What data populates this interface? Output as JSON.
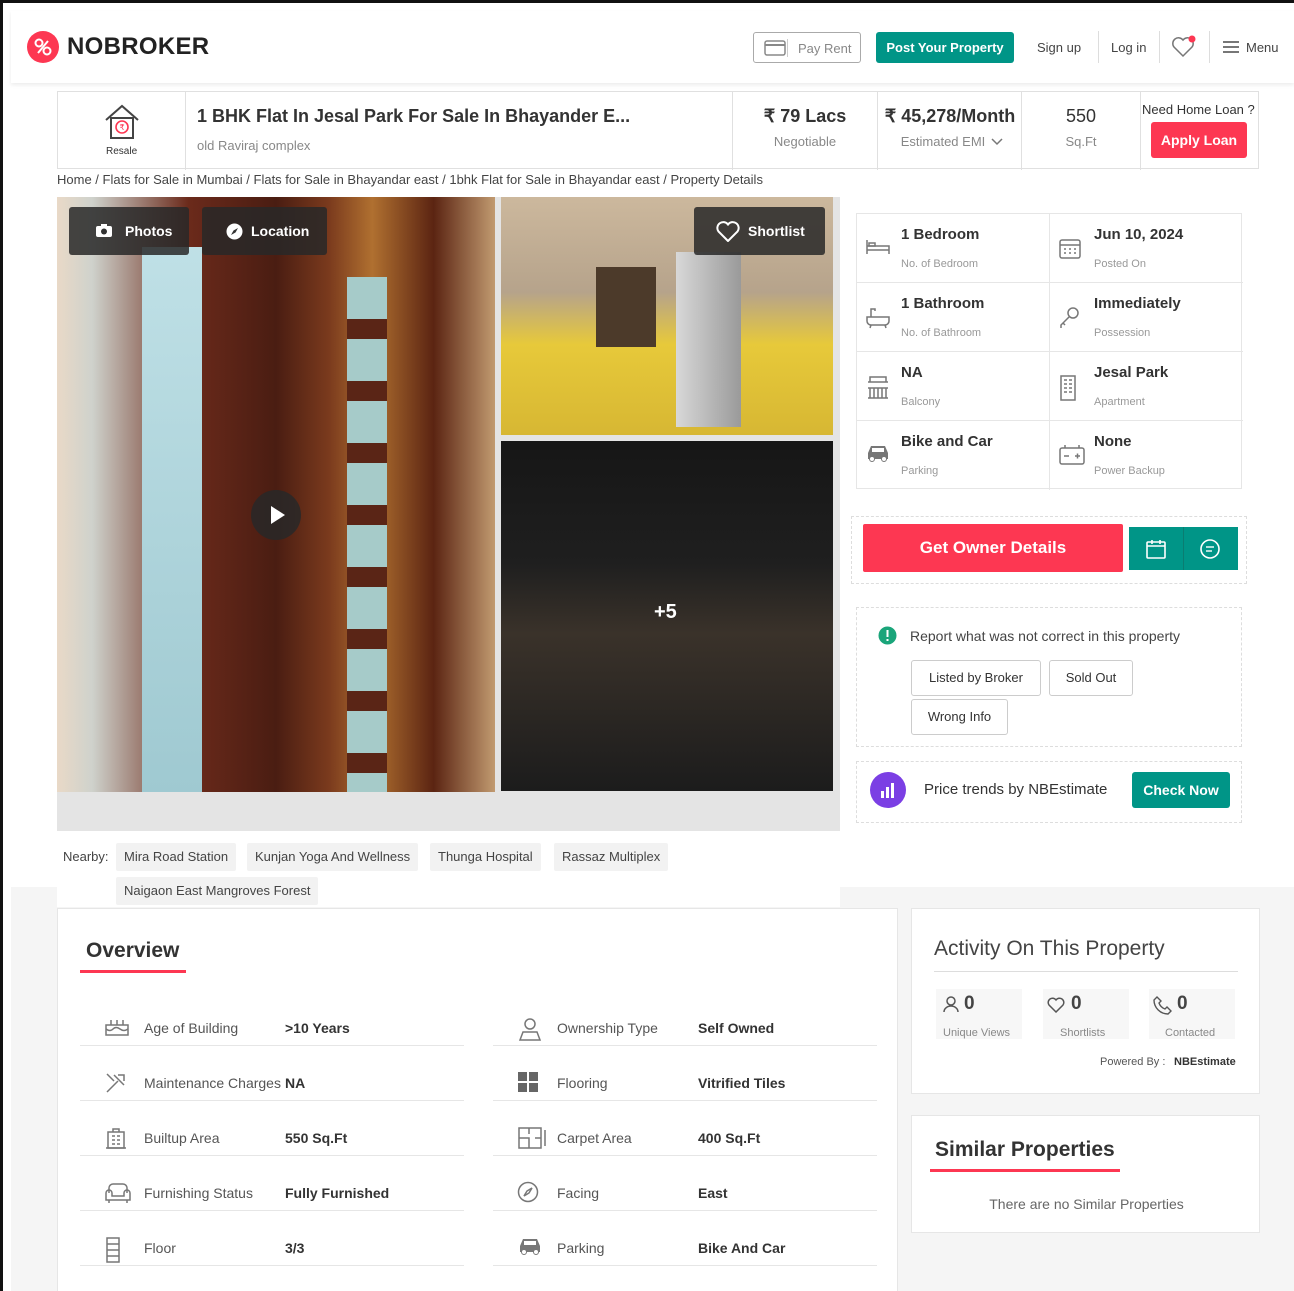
{
  "header": {
    "logo_text": "NOBROKER",
    "pay_rent": "Pay Rent",
    "post_property": "Post Your Property",
    "sign_up": "Sign up",
    "log_in": "Log in",
    "menu": "Menu",
    "brand_color": "#fd3752",
    "accent_color": "#009587"
  },
  "summary": {
    "badge": "Resale",
    "title": "1 BHK Flat In Jesal Park For Sale In Bhayander E...",
    "subtitle": "old Raviraj complex",
    "price": "₹ 79 Lacs",
    "price_note": "Negotiable",
    "emi": "₹ 45,278/Month",
    "emi_note": "Estimated EMI",
    "area": "550",
    "area_unit": "Sq.Ft",
    "loan_prompt": "Need Home Loan ?",
    "apply_loan": "Apply Loan"
  },
  "breadcrumb": "Home / Flats for Sale in Mumbai / Flats for Sale in Bhayandar east / 1bhk Flat for Sale in Bhayandar east / Property Details",
  "gallery": {
    "photos": "Photos",
    "location": "Location",
    "shortlist": "Shortlist",
    "more_count": "+5"
  },
  "details": [
    {
      "value": "1 Bedroom",
      "label": "No. of Bedroom",
      "icon": "bed-icon"
    },
    {
      "value": "Jun 10, 2024",
      "label": "Posted On",
      "icon": "calendar-icon"
    },
    {
      "value": "1 Bathroom",
      "label": "No. of Bathroom",
      "icon": "bathtub-icon"
    },
    {
      "value": "Immediately",
      "label": "Possession",
      "icon": "key-icon"
    },
    {
      "value": "NA",
      "label": "Balcony",
      "icon": "balcony-icon"
    },
    {
      "value": "Jesal Park",
      "label": "Apartment",
      "icon": "building-icon"
    },
    {
      "value": "Bike and Car",
      "label": "Parking",
      "icon": "car-icon"
    },
    {
      "value": "None",
      "label": "Power Backup",
      "icon": "battery-icon"
    }
  ],
  "owner": {
    "get_owner": "Get Owner Details"
  },
  "report": {
    "prompt": "Report what was not correct in this property",
    "options": [
      "Listed by Broker",
      "Sold Out",
      "Wrong Info"
    ]
  },
  "trends": {
    "text": "Price trends by NBEstimate",
    "check_now": "Check Now"
  },
  "nearby": {
    "label": "Nearby:",
    "places": [
      "Mira Road Station",
      "Kunjan Yoga And Wellness",
      "Thunga Hospital",
      "Rassaz Multiplex",
      "Naigaon East Mangroves Forest"
    ]
  },
  "overview": {
    "heading": "Overview",
    "rows_left": [
      {
        "label": "Age of Building",
        "value": ">10 Years",
        "icon": "cake-icon"
      },
      {
        "label": "Maintenance Charges",
        "value": "NA",
        "icon": "tools-icon"
      },
      {
        "label": "Builtup Area",
        "value": "550 Sq.Ft",
        "icon": "building-area-icon"
      },
      {
        "label": "Furnishing Status",
        "value": "Fully Furnished",
        "icon": "sofa-icon"
      },
      {
        "label": "Floor",
        "value": "3/3",
        "icon": "floor-icon"
      }
    ],
    "rows_right": [
      {
        "label": "Ownership Type",
        "value": "Self Owned",
        "icon": "ownership-icon"
      },
      {
        "label": "Flooring",
        "value": "Vitrified Tiles",
        "icon": "tiles-icon"
      },
      {
        "label": "Carpet Area",
        "value": "400 Sq.Ft",
        "icon": "carpet-area-icon"
      },
      {
        "label": "Facing",
        "value": "East",
        "icon": "compass-icon"
      },
      {
        "label": "Parking",
        "value": "Bike And Car",
        "icon": "car-icon"
      }
    ]
  },
  "activity": {
    "heading": "Activity On This Property",
    "stats": [
      {
        "value": "0",
        "label": "Unique Views",
        "icon": "user-icon"
      },
      {
        "value": "0",
        "label": "Shortlists",
        "icon": "heart-icon"
      },
      {
        "value": "0",
        "label": "Contacted",
        "icon": "phone-icon"
      }
    ],
    "powered_by": "Powered By :",
    "powered_brand": "NBEstimate"
  },
  "similar": {
    "heading": "Similar Properties",
    "empty": "There are no Similar Properties"
  }
}
